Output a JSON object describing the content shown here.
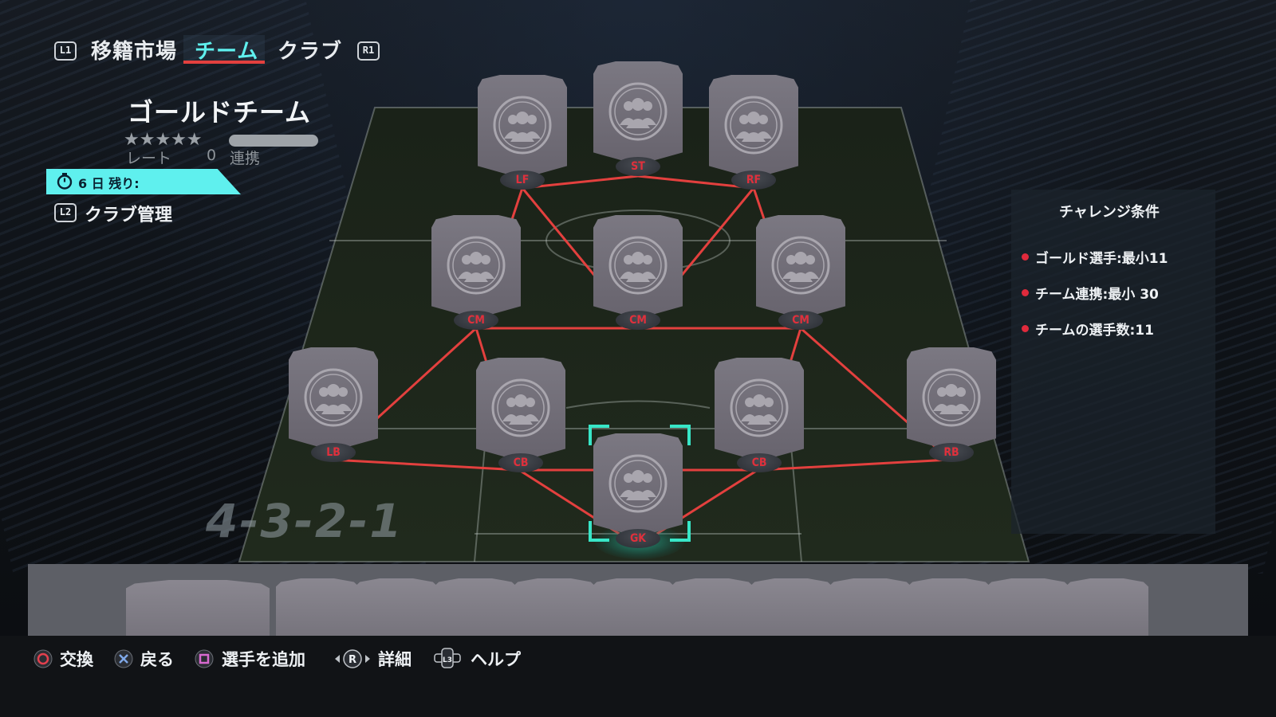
{
  "nav": {
    "left_button": "L1",
    "right_button": "R1",
    "tabs": [
      {
        "label": "移籍市場"
      },
      {
        "label": "チーム"
      },
      {
        "label": "クラブ"
      }
    ]
  },
  "squad": {
    "name": "ゴールドチーム",
    "stars": "★★★★★",
    "rating_label": "レート",
    "rating_value": "0",
    "chemistry_label": "連携"
  },
  "timer": {
    "text": "6 日 残り:"
  },
  "club_management": {
    "button": "L2",
    "label": "クラブ管理"
  },
  "challenge": {
    "title": "チャレンジ条件",
    "requirements": [
      {
        "text": "ゴールド選手:最小11"
      },
      {
        "text": "チーム連携:最小 30"
      },
      {
        "text": "チームの選手数:11"
      }
    ]
  },
  "formation": "4-3-2-1",
  "positions": {
    "lf": "LF",
    "st": "ST",
    "rf": "RF",
    "cm_left": "CM",
    "cm_center": "CM",
    "cm_right": "CM",
    "lb": "LB",
    "cb_left": "CB",
    "cb_right": "CB",
    "rb": "RB",
    "gk": "GK"
  },
  "controls": [
    {
      "label": "交換",
      "icon": "circle-button-icon"
    },
    {
      "label": "戻る",
      "icon": "cross-button-icon"
    },
    {
      "label": "選手を追加",
      "icon": "square-button-icon"
    },
    {
      "label": "詳細",
      "icon": "right-stick-icon"
    },
    {
      "label": "ヘルプ",
      "icon": "l3-stick-icon"
    }
  ],
  "colors": {
    "accent_cyan": "#5ff0ee",
    "link_red": "#e3403e",
    "card_grey": "#6f6c75",
    "gk_highlight": "#38e6c7"
  }
}
